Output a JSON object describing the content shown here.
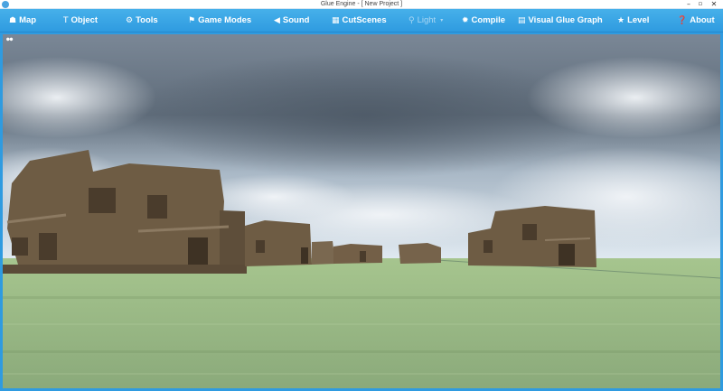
{
  "window": {
    "title": "Glue Engine - [ New Project ]",
    "controls": {
      "minimize": "–",
      "maximize": "▫",
      "close": "✕"
    }
  },
  "menu": {
    "items": [
      {
        "id": "map",
        "label": "Map",
        "icon": "map-icon",
        "glyph": "☗"
      },
      {
        "id": "object",
        "label": "Object",
        "icon": "object-icon",
        "glyph": "T"
      },
      {
        "id": "tools",
        "label": "Tools",
        "icon": "tools-icon",
        "glyph": "⚙"
      },
      {
        "id": "game-modes",
        "label": "Game Modes",
        "icon": "flag-icon",
        "glyph": "⚑"
      },
      {
        "id": "sound",
        "label": "Sound",
        "icon": "speaker-icon",
        "glyph": "◀"
      },
      {
        "id": "cutscenes",
        "label": "CutScenes",
        "icon": "film-icon",
        "glyph": "▦"
      },
      {
        "id": "light",
        "label": "Light",
        "icon": "bulb-icon",
        "glyph": "⚲",
        "disabled": true,
        "caret": "▾"
      },
      {
        "id": "compile",
        "label": "Compile",
        "icon": "gear-icon",
        "glyph": "✹"
      },
      {
        "id": "visual-glue-graph",
        "label": "Visual Glue Graph",
        "icon": "graph-icon",
        "glyph": "▤"
      },
      {
        "id": "level",
        "label": "Level",
        "icon": "star-icon",
        "glyph": "★"
      },
      {
        "id": "about",
        "label": "About",
        "icon": "question-icon",
        "glyph": "❓"
      }
    ]
  },
  "viewport": {
    "corner_label": "●●",
    "colors": {
      "sky_top": "#5d6b79",
      "sky_bottom": "#dfe9f1",
      "ground": "#8fb67a",
      "building": "#6b5a42"
    }
  }
}
